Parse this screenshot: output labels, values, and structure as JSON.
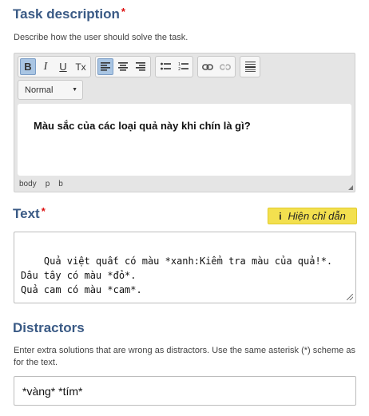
{
  "task": {
    "title": "Task description",
    "required_mark": "*",
    "description": "Describe how the user should solve the task.",
    "toolbar": {
      "bold": "B",
      "italic": "I",
      "underline": "U",
      "remove_format": "Tx"
    },
    "format_select": "Normal",
    "editor_content": "Màu sắc của các loại quả này khi chín là gì?",
    "path": [
      "body",
      "p",
      "b"
    ]
  },
  "text": {
    "title": "Text",
    "required_mark": "*",
    "tip_button": "Hiện chỉ dẫn",
    "tip_icon": "i",
    "value": "Quả việt quất có màu *xanh:Kiểm tra màu của quả!*.\nDâu tây có màu *đỏ*.\nQuả cam có màu *cam*."
  },
  "distractors": {
    "title": "Distractors",
    "description": "Enter extra solutions that are wrong as distractors. Use the same asterisk (*) scheme as for the text.",
    "value": "*vàng* *tím*"
  },
  "colors": {
    "title": "#3a5a85",
    "required": "#dd1111",
    "tip_background": "#f3e04f",
    "active_tool": "#a9c5e3"
  }
}
